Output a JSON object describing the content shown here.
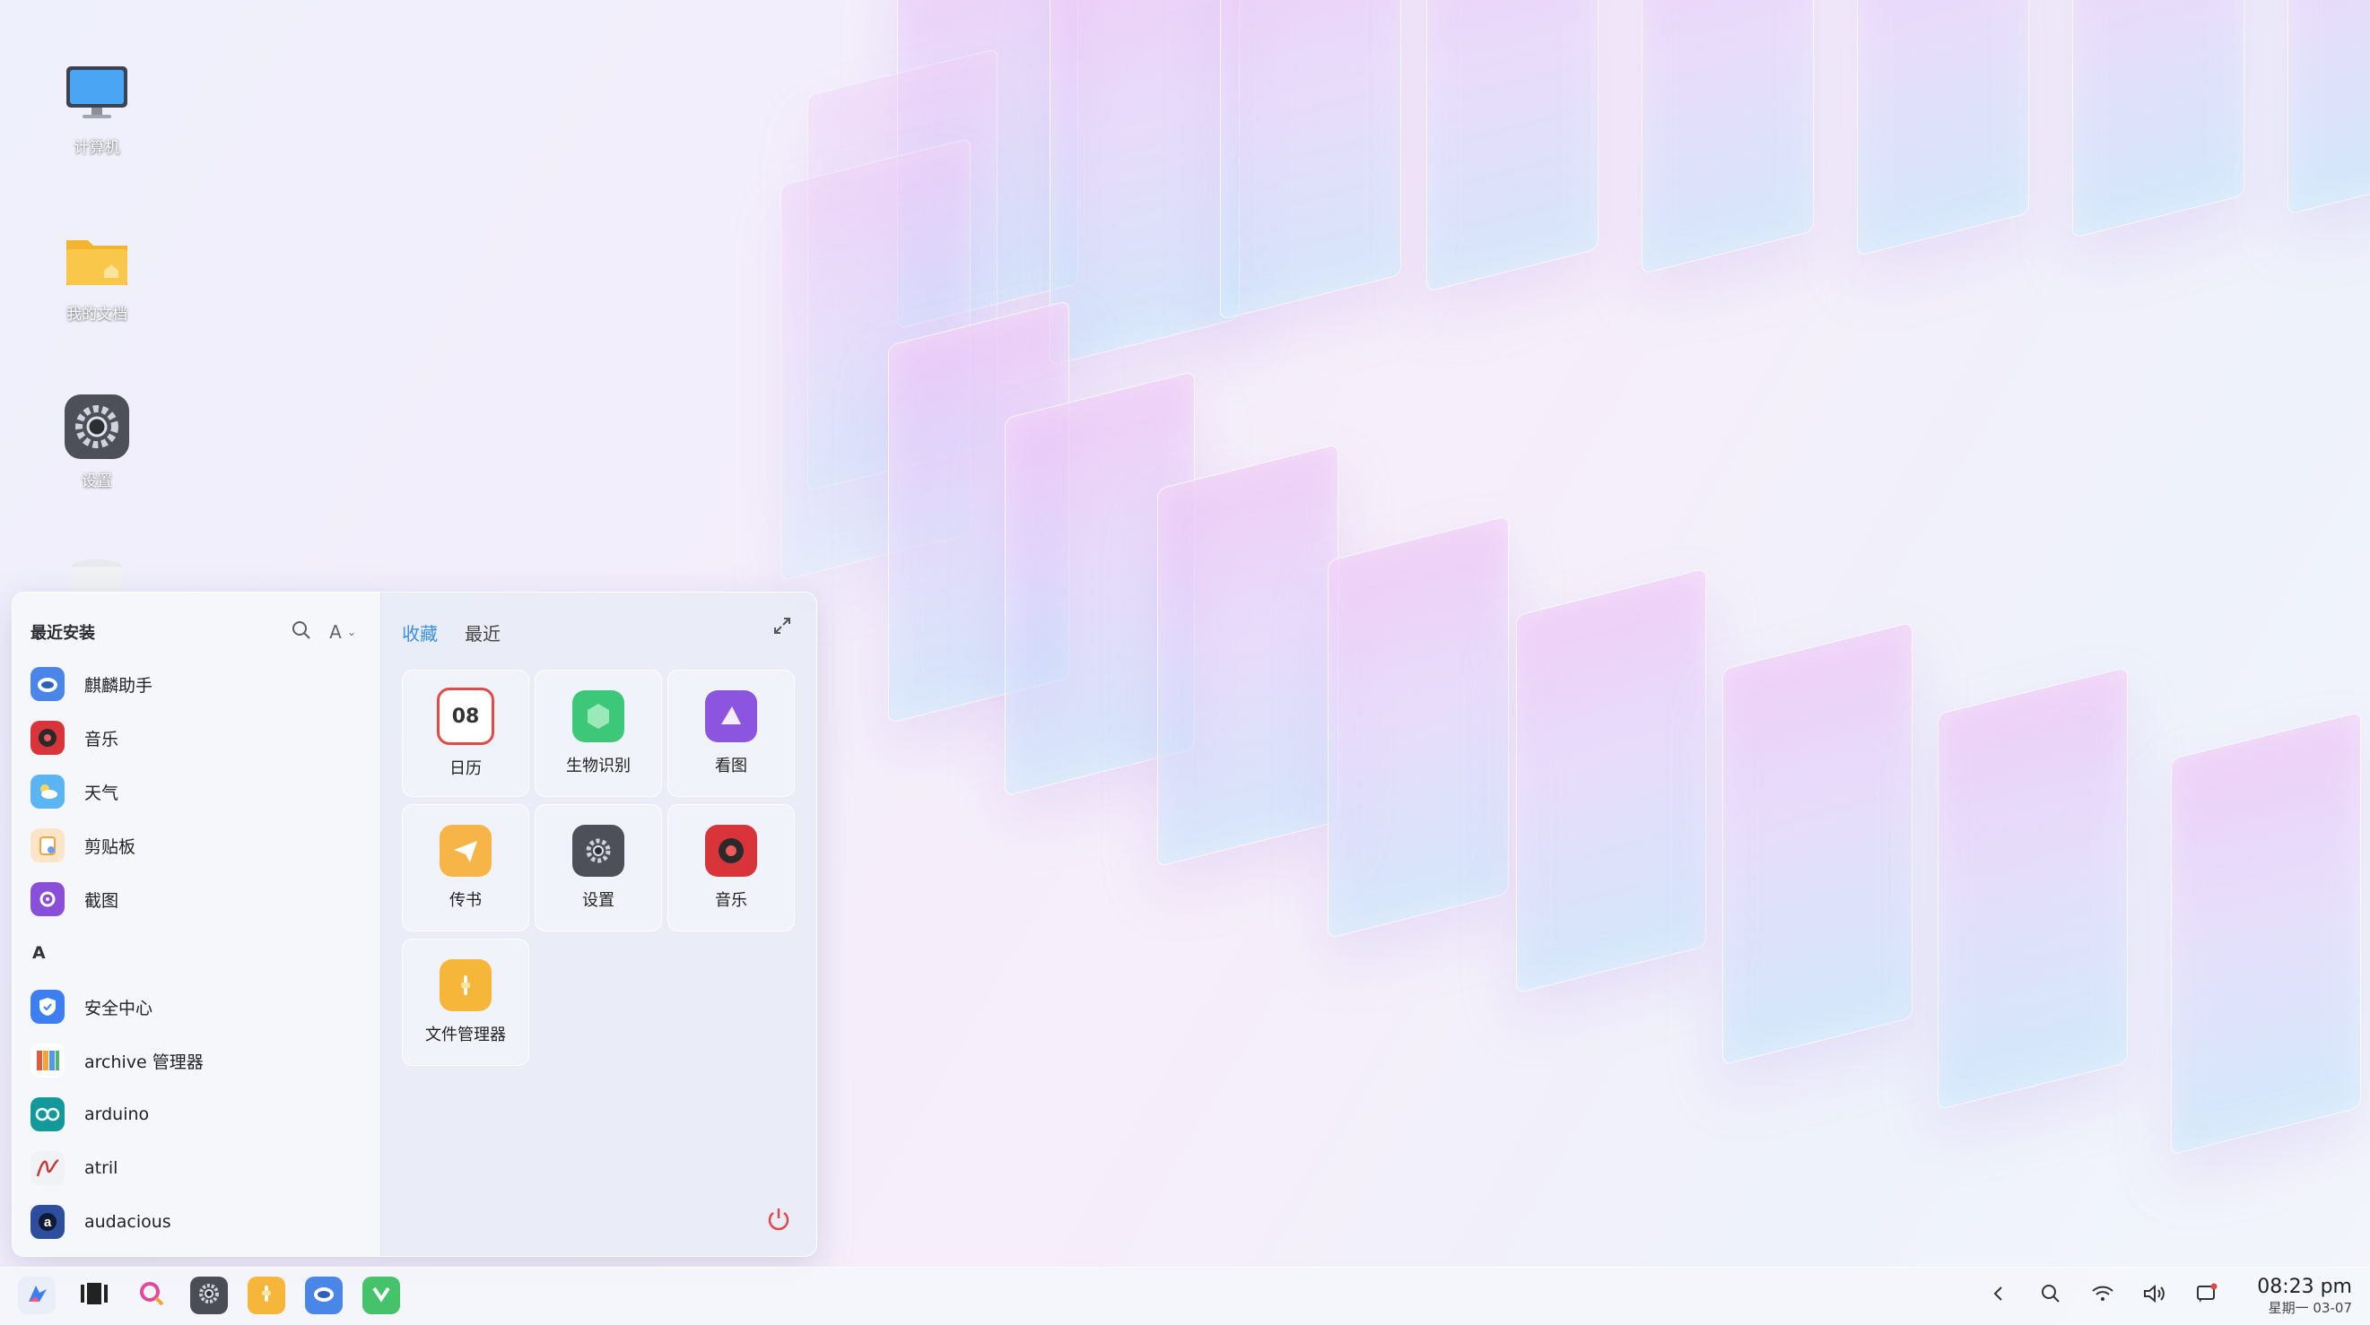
{
  "desktop": {
    "icons": [
      {
        "label": "计算机",
        "icon": "computer-icon"
      },
      {
        "label": "我的文档",
        "icon": "folder-icon"
      },
      {
        "label": "设置",
        "icon": "settings-icon"
      },
      {
        "label": "",
        "icon": "trash-icon"
      }
    ]
  },
  "start_menu": {
    "left": {
      "title": "最近安装",
      "search_icon": "search-icon",
      "letter_filter": "A",
      "recent": [
        {
          "name": "麒麟助手",
          "icon": "kylin-assistant-icon",
          "color": "#4a86e8"
        },
        {
          "name": "音乐",
          "icon": "music-icon",
          "color": "#d9343a"
        },
        {
          "name": "天气",
          "icon": "weather-icon",
          "color": "#5bb5f2"
        },
        {
          "name": "剪贴板",
          "icon": "clipboard-icon",
          "color": "#f4a340"
        },
        {
          "name": "截图",
          "icon": "screenshot-icon",
          "color": "#8a4fd8"
        }
      ],
      "section_a": "A",
      "apps_a": [
        {
          "name": "安全中心",
          "icon": "security-center-icon",
          "color": "#3d7ff0"
        },
        {
          "name": "archive 管理器",
          "icon": "archive-icon",
          "color": "#f29c38"
        },
        {
          "name": "arduino",
          "icon": "arduino-icon",
          "color": "#13999b"
        },
        {
          "name": "atril",
          "icon": "atril-icon",
          "color": "#c83a3a"
        },
        {
          "name": "audacious",
          "icon": "audacious-icon",
          "color": "#2c4e9c"
        }
      ]
    },
    "right": {
      "tabs": [
        {
          "label": "收藏",
          "active": true
        },
        {
          "label": "最近",
          "active": false
        }
      ],
      "tiles": [
        {
          "label": "日历",
          "icon": "calendar-icon",
          "glyph": "08"
        },
        {
          "label": "生物识别",
          "icon": "biometrics-icon",
          "glyph": ""
        },
        {
          "label": "看图",
          "icon": "image-viewer-icon",
          "glyph": ""
        },
        {
          "label": "传书",
          "icon": "file-transfer-icon",
          "glyph": ""
        },
        {
          "label": "设置",
          "icon": "settings-icon",
          "glyph": ""
        },
        {
          "label": "音乐",
          "icon": "music-icon",
          "glyph": ""
        },
        {
          "label": "文件管理器",
          "icon": "file-manager-icon",
          "glyph": ""
        }
      ]
    }
  },
  "taskbar": {
    "apps": [
      {
        "icon": "start-menu-icon",
        "color": "#e9eef8"
      },
      {
        "icon": "multitask-view-icon",
        "color": "#2b2b2b"
      },
      {
        "icon": "search-app-icon",
        "color": "#e04a9a"
      },
      {
        "icon": "settings-icon",
        "color": "#4a4d55"
      },
      {
        "icon": "file-manager-icon",
        "color": "#f6b63a"
      },
      {
        "icon": "kylin-assistant-icon",
        "color": "#4a86e8"
      },
      {
        "icon": "software-store-icon",
        "color": "#46c36a"
      }
    ],
    "tray": [
      "chevron-left-icon",
      "search-icon",
      "wifi-icon",
      "volume-icon",
      "notification-icon"
    ],
    "clock": {
      "time": "08:23 pm",
      "date": "星期一  03-07"
    }
  }
}
